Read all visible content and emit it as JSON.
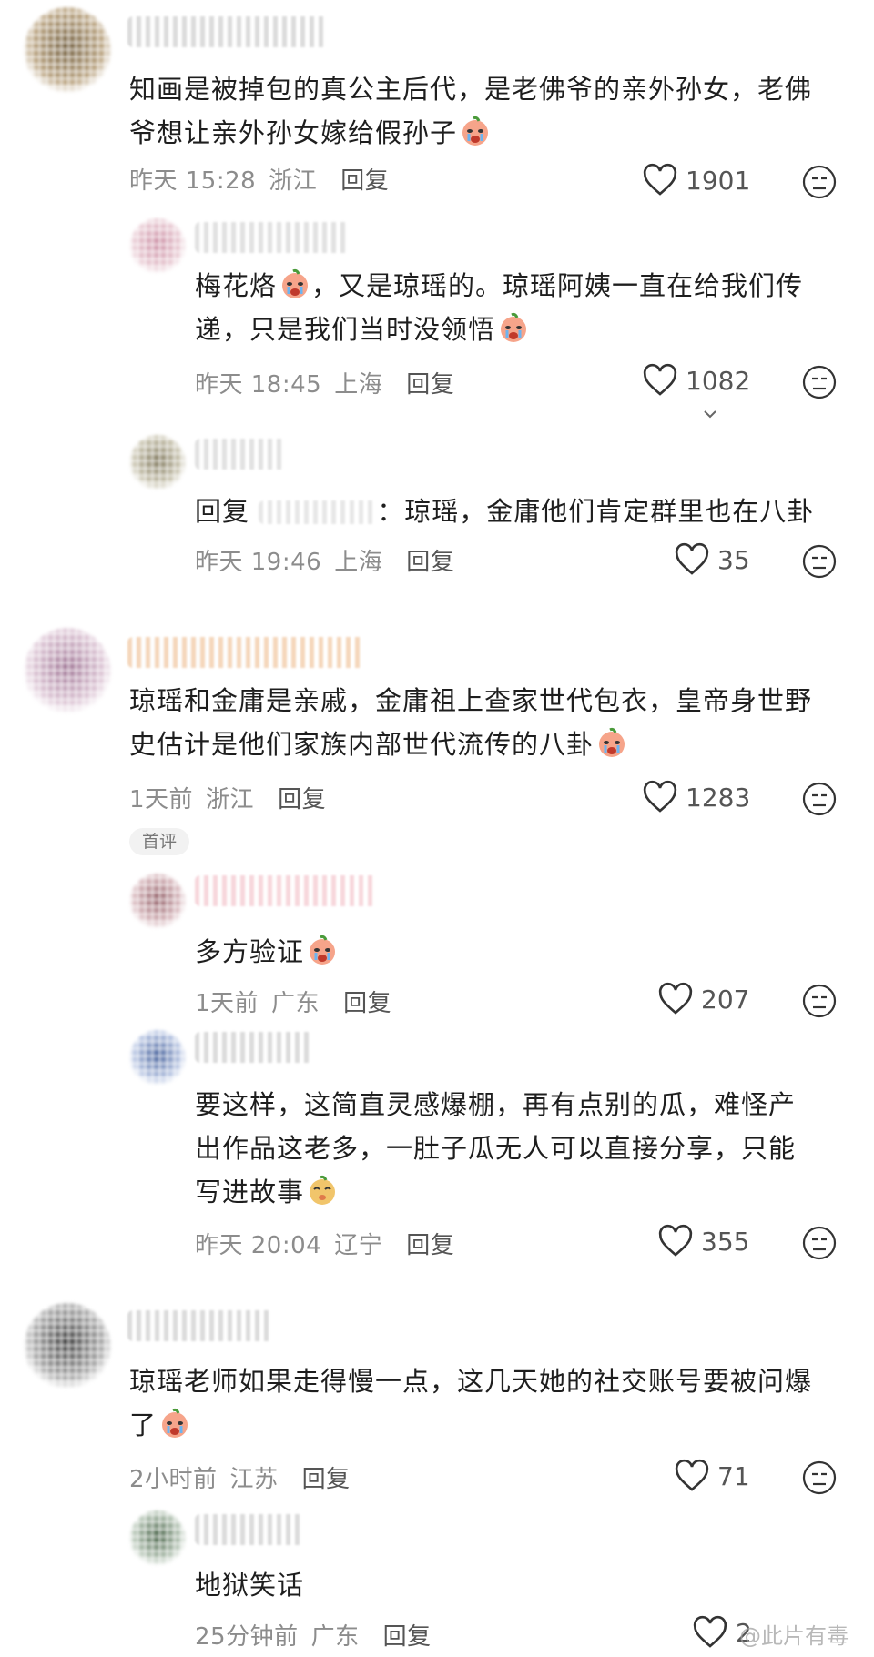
{
  "comments": [
    {
      "text": "知画是被掉包的真公主后代，是老佛爷的亲外孙女，老佛\n爷想让亲外孙女嫁给假孙子",
      "emoji": "cry",
      "time": "昨天 15:28",
      "loc": "浙江",
      "reply": "回复",
      "likes": "1901"
    },
    {
      "text": "梅花烙",
      "emoji_mid": "cry",
      "text2": "，又是琼瑶的。琼瑶阿姨一直在给我们传\n递，只是我们当时没领悟",
      "emoji": "cry",
      "time": "昨天 18:45",
      "loc": "上海",
      "reply": "回复",
      "likes": "1082"
    },
    {
      "text": "回复 ",
      "blur_name": true,
      "text2": "：琼瑶，金庸他们肯定群里也在八卦",
      "time": "昨天 19:46",
      "loc": "上海",
      "reply": "回复",
      "likes": "35"
    },
    {
      "text": "琼瑶和金庸是亲戚，金庸祖上查家世代包衣，皇帝身世野\n史估计是他们家族内部世代流传的八卦",
      "emoji": "cry",
      "time": "1天前",
      "loc": "浙江",
      "reply": "回复",
      "likes": "1283"
    },
    {
      "badge": "首评",
      "text": "多方验证",
      "emoji": "cry",
      "time": "1天前",
      "loc": "广东",
      "reply": "回复",
      "likes": "207"
    },
    {
      "text": "要这样，这简直灵感爆棚，再有点别的瓜，难怪产\n出作品这老多，一肚子瓜无人可以直接分享，只能\n写进故事",
      "emoji": "dog",
      "time": "昨天 20:04",
      "loc": "辽宁",
      "reply": "回复",
      "likes": "355"
    },
    {
      "text": "琼瑶老师如果走得慢一点，这几天她的社交账号要被问爆\n了",
      "emoji": "cry",
      "time": "2小时前",
      "loc": "江苏",
      "reply": "回复",
      "likes": "71"
    },
    {
      "text": "地狱笑话",
      "time": "25分钟前",
      "loc": "广东",
      "reply": "回复",
      "likes": "2"
    }
  ],
  "watermark": "@此片有毒",
  "icons": {
    "like": "heart-outline-icon",
    "more": "meh-face-icon",
    "emoji_cry": "crying-emoji",
    "emoji_dog": "dog-emoji"
  }
}
